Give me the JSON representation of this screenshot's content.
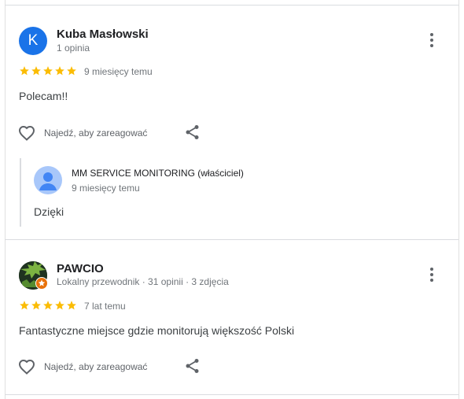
{
  "reviews": [
    {
      "avatar_letter": "K",
      "name": "Kuba Masłowski",
      "meta": "1 opinia",
      "rating": 5,
      "date": "9 miesięcy temu",
      "text": "Polecam!!",
      "react_label": "Najedź, aby zareagować",
      "owner_reply": {
        "name": "MM SERVICE MONITORING (właściciel)",
        "date": "9 miesięcy temu",
        "text": "Dzięki"
      }
    },
    {
      "name": "PAWCIO",
      "meta": "Lokalny przewodnik · 31 opinii · 3 zdjęcia",
      "rating": 5,
      "date": "7 lat temu",
      "text": "Fantastyczne miejsce gdzie monitorują większość Polski",
      "react_label": "Najedź, aby zareagować"
    }
  ],
  "colors": {
    "star": "#fbbc04",
    "avatar_blue": "#1a73e8",
    "guide_badge": "#e8710a"
  }
}
